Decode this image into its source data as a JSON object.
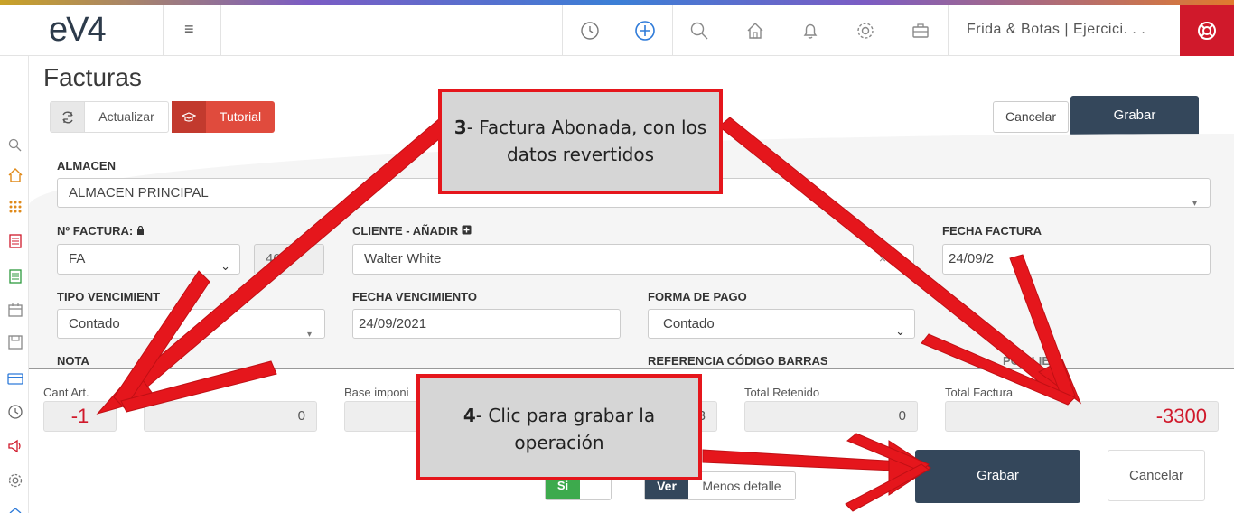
{
  "app": {
    "logo": "eV4",
    "company": "Frida & Botas | Ejercici. . .",
    "accent": "#34475b",
    "danger": "#d0192b"
  },
  "header": {
    "icons": [
      "history-icon",
      "add-circle-icon",
      "search-icon",
      "home-icon",
      "bell-icon",
      "gear-icon",
      "briefcase-icon"
    ]
  },
  "sidebar": {
    "icons": [
      "search-icon",
      "home-icon",
      "grid-icon",
      "invoice-red-icon",
      "invoice-green-icon",
      "calendar-icon",
      "save-icon",
      "card-icon",
      "clock-icon",
      "megaphone-icon",
      "gear-icon",
      "chevron-up-icon"
    ]
  },
  "page": {
    "title": "Facturas",
    "refresh_label": "Actualizar",
    "tutorial_label": "Tutorial",
    "cancel_label": "Cancelar",
    "save_label": "Grabar"
  },
  "form": {
    "almacen_label": "ALMACEN",
    "almacen_value": "ALMACEN PRINCIPAL",
    "nfactura_label": "Nº FACTURA:",
    "serie_value": "FA",
    "numero_value": "40",
    "cliente_label": "CLIENTE - ",
    "cliente_add": "AÑADIR",
    "cliente_value": "Walter White",
    "fecha_factura_label": "FECHA FACTURA",
    "fecha_factura_value": "24/09/2",
    "tipo_venc_label": "TIPO VENCIMIENT",
    "tipo_venc_value": "Contado",
    "fecha_venc_label": "FECHA VENCIMIENTO",
    "fecha_venc_value": "24/09/2021",
    "forma_pago_label": "FORMA DE PAGO",
    "forma_pago_value": "Contado",
    "nota_label": "NOTA",
    "ref_barras_label": "REFERENCIA CÓDIGO BARRAS",
    "partial_label": "PO CLIEN"
  },
  "totals": {
    "cant_label": "Cant Art.",
    "cant_value": "-1",
    "second_value": "0",
    "base_label": "Base imponi",
    "base_partial_value": "3",
    "retenido_label": "Total Retenido",
    "retenido_value": "0",
    "total_label": "Total Factura",
    "total_value": "-3300"
  },
  "footer": {
    "si_label": "Si",
    "ver_label": "Ver",
    "menos_label": "Menos detalle",
    "save_label": "Grabar",
    "cancel_label": "Cancelar"
  },
  "callouts": {
    "c3_num": "3",
    "c3_text": "- Factura Abonada, con los datos revertidos",
    "c4_num": "4",
    "c4_text": "- Clic para grabar la operación"
  }
}
